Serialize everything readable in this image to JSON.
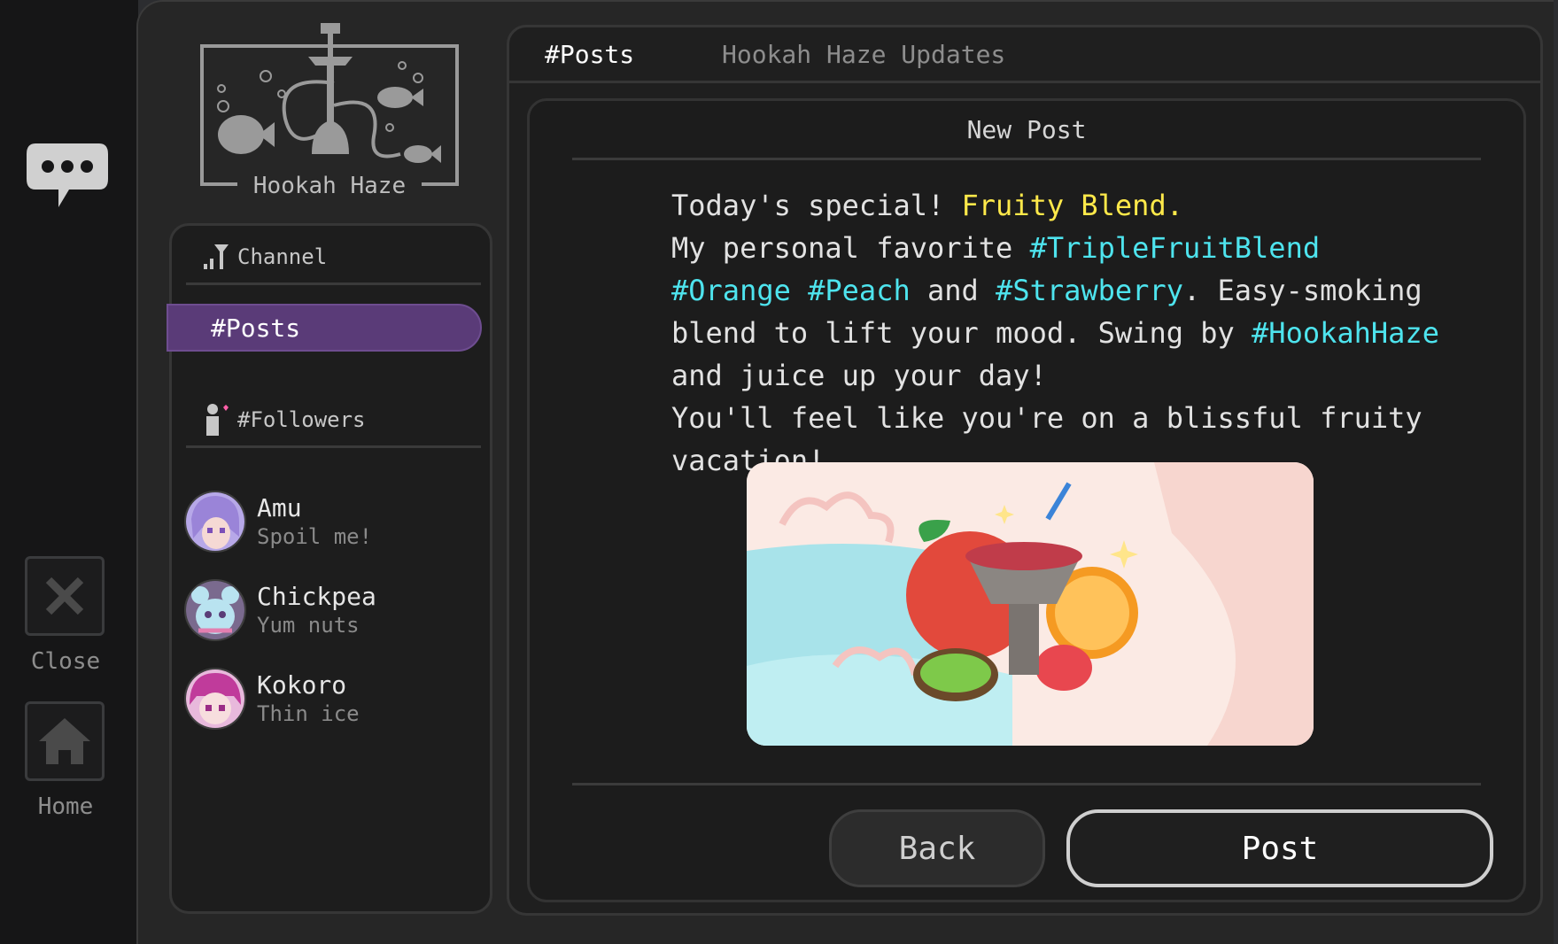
{
  "rail": {
    "close_label": "Close",
    "home_label": "Home"
  },
  "logo": {
    "text": "Hookah Haze"
  },
  "sidebar": {
    "channel_header": "Channel",
    "channel_active": "#Posts",
    "followers_header": "#Followers",
    "followers": [
      {
        "name": "Amu",
        "status": "Spoil me!"
      },
      {
        "name": "Chickpea",
        "status": "Yum nuts"
      },
      {
        "name": "Kokoro",
        "status": "Thin ice"
      }
    ]
  },
  "tabs": {
    "active": "#Posts",
    "inactive": "Hookah Haze Updates"
  },
  "post": {
    "title": "New Post",
    "line1_a": "Today's special! ",
    "line1_highlight": "Fruity Blend.",
    "line2_a": "My personal favorite ",
    "tag1": "#TripleFruitBlend",
    "tag2": "#Orange",
    "tag3": "#Peach",
    "line3_a": "and ",
    "tag4": "#Strawberry",
    "line3_b": ". Easy-smoking blend to lift your mood. Swing by ",
    "tag5": "#HookahHaze",
    "line4_b": " and juice up your day!",
    "line5": "You'll feel like you're on a blissful fruity vacation!",
    "back_label": "Back",
    "post_label": "Post"
  },
  "colors": {
    "accent_purple": "#5a3b78",
    "highlight_yellow": "#ffe94a",
    "hashtag_cyan": "#4ee4ee"
  }
}
